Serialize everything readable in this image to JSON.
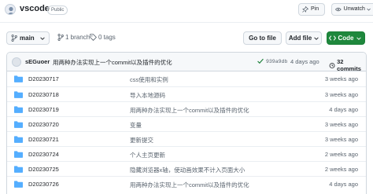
{
  "repo": {
    "name": "vscode",
    "visibility": "Public",
    "pin_label": "Pin",
    "watch_label": "Unwatch"
  },
  "toolbar": {
    "branch_label": "main",
    "branches_label": "1 branch",
    "tags_label": "0 tags",
    "go_to_file_label": "Go to file",
    "add_file_label": "Add file",
    "code_label": "Code"
  },
  "latest_commit": {
    "author": "sEGuoer",
    "message": "用两种办法实现上一个commit以及插件的优化",
    "hash": "939a9db",
    "time": "4 days ago",
    "count_label": "32 commits"
  },
  "files": [
    {
      "name": "D20230717",
      "message": "css使用和实例",
      "time": "3 weeks ago"
    },
    {
      "name": "D20230718",
      "message": "导入本地源码",
      "time": "3 weeks ago"
    },
    {
      "name": "D20230719",
      "message": "用两种办法实现上一个commit以及插件的优化",
      "time": "4 days ago"
    },
    {
      "name": "D20230720",
      "message": "变量",
      "time": "3 weeks ago"
    },
    {
      "name": "D20230721",
      "message": "更新提交",
      "time": "3 weeks ago"
    },
    {
      "name": "D20230724",
      "message": "个人主页更新",
      "time": "2 weeks ago"
    },
    {
      "name": "D20230725",
      "message": "隐藏浏览器x轴，使动画效果不计入页面大小",
      "time": "2 weeks ago"
    },
    {
      "name": "D20230726",
      "message": "用两种办法实现上一个commit以及插件的优化",
      "time": "4 days ago"
    }
  ],
  "colors": {
    "accent_green": "#1f883d",
    "folder_blue": "#54aeff",
    "muted_text": "#59636e"
  },
  "icons": {
    "pin": "pin-icon",
    "watch": "eye-icon",
    "branch": "git-branch-icon",
    "tag": "tag-icon",
    "code": "code-icon",
    "check": "check-icon",
    "history": "history-icon",
    "folder": "folder-icon"
  }
}
